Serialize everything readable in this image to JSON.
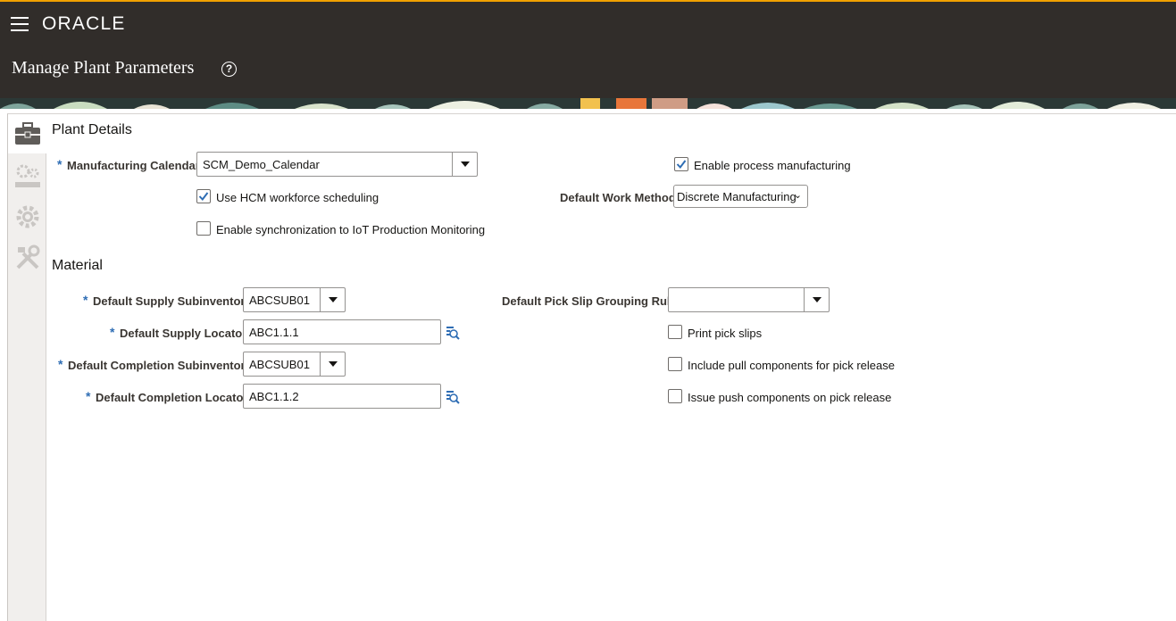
{
  "brand": {
    "logo_text": "ORACLE",
    "accent_color": "#f0a000",
    "header_bg": "#312d2a"
  },
  "page": {
    "title": "Manage Plant Parameters",
    "help_icon": "question-circle-icon"
  },
  "vertical_tabs": [
    {
      "icon": "briefcase-icon",
      "active": true
    },
    {
      "icon": "gears-ruler-icon",
      "active": false
    },
    {
      "icon": "gear-icon",
      "active": false
    },
    {
      "icon": "tools-icon",
      "active": false
    }
  ],
  "plant_details": {
    "title": "Plant Details",
    "manufacturing_calendar": {
      "label": "Manufacturing Calendar",
      "required": "*",
      "value": "SCM_Demo_Calendar"
    },
    "use_hcm": {
      "label": "Use HCM workforce scheduling",
      "checked": true
    },
    "enable_iot": {
      "label": "Enable synchronization to IoT Production Monitoring",
      "checked": false
    },
    "enable_process": {
      "label": "Enable process manufacturing",
      "checked": true
    },
    "default_work_method": {
      "label": "Default Work Method",
      "value": "Discrete Manufacturing"
    }
  },
  "material": {
    "title": "Material",
    "supply_subinventory": {
      "label": "Default Supply Subinventory",
      "required": "*",
      "value": "ABCSUB01"
    },
    "supply_locator": {
      "label": "Default Supply Locator",
      "required": "*",
      "value": "ABC1.1.1"
    },
    "completion_subinventory": {
      "label": "Default Completion Subinventory",
      "required": "*",
      "value": "ABCSUB01"
    },
    "completion_locator": {
      "label": "Default Completion Locator",
      "required": "*",
      "value": "ABC1.1.2"
    },
    "pick_slip_rule": {
      "label": "Default Pick Slip Grouping Rule",
      "value": ""
    },
    "print_pick_slips": {
      "label": "Print pick slips",
      "checked": false
    },
    "include_pull": {
      "label": "Include pull components for pick release",
      "checked": false
    },
    "issue_push": {
      "label": "Issue push components on pick release",
      "checked": false
    }
  }
}
